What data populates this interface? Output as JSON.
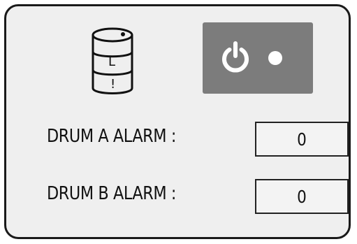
{
  "drum_icon": {
    "icon": "oil-drum-icon",
    "labels": [
      "L",
      "!"
    ]
  },
  "power_button": {
    "icon": "power-icon",
    "indicator": "status-dot",
    "colors": {
      "background": "#7c7c7c",
      "foreground": "#ffffff"
    }
  },
  "alarms": [
    {
      "label": "DRUM A ALARM :",
      "value": "0"
    },
    {
      "label": "DRUM B ALARM :",
      "value": "0"
    }
  ],
  "colors": {
    "panel_background": "#efefef",
    "panel_border": "#1a1a1a"
  }
}
